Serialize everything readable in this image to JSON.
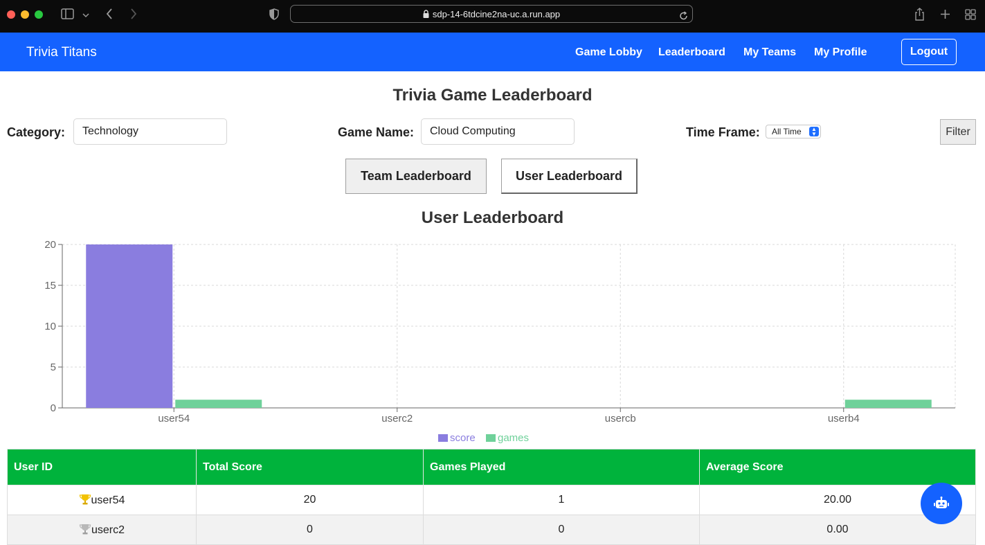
{
  "browser": {
    "url": "sdp-14-6tdcine2na-uc.a.run.app",
    "icons": [
      "sidebar-icon",
      "chevron-down-icon",
      "back-icon",
      "forward-icon",
      "shield-icon",
      "lock-icon",
      "reload-icon",
      "share-icon",
      "new-tab-icon",
      "tab-overview-icon"
    ]
  },
  "navbar": {
    "brand": "Trivia Titans",
    "links": [
      "Game Lobby",
      "Leaderboard",
      "My Teams",
      "My Profile"
    ],
    "logout": "Logout",
    "color": "#1462ff"
  },
  "page": {
    "title": "Trivia Game Leaderboard",
    "filters": {
      "category_label": "Category:",
      "category_value": "Technology",
      "game_label": "Game Name:",
      "game_value": "Cloud Computing",
      "time_label": "Time Frame:",
      "time_value": "All Time",
      "filter_button": "Filter"
    },
    "tabs": [
      "Team Leaderboard",
      "User Leaderboard"
    ],
    "section_title": "User Leaderboard"
  },
  "chart_data": {
    "type": "bar",
    "categories": [
      "user54",
      "userc2",
      "usercb",
      "userb4"
    ],
    "series": [
      {
        "name": "score",
        "values": [
          20,
          0,
          0,
          0
        ],
        "color": "#8a7ddf"
      },
      {
        "name": "games",
        "values": [
          1,
          0,
          0,
          1
        ],
        "color": "#6fd19a"
      }
    ],
    "ylim": [
      0,
      20
    ],
    "yticks": [
      0,
      5,
      10,
      15,
      20
    ],
    "grid": true,
    "legend": "bottom-center"
  },
  "table": {
    "headers": [
      "User ID",
      "Total Score",
      "Games Played",
      "Average Score"
    ],
    "header_color": "#00b33c",
    "rows": [
      {
        "trophy": "gold-trophy-icon",
        "user": "user54",
        "score": "20",
        "games": "1",
        "avg": "20.00"
      },
      {
        "trophy": "silver-trophy-icon",
        "user": "userc2",
        "score": "0",
        "games": "0",
        "avg": "0.00"
      }
    ]
  },
  "fab": {
    "icon": "robot-icon"
  }
}
